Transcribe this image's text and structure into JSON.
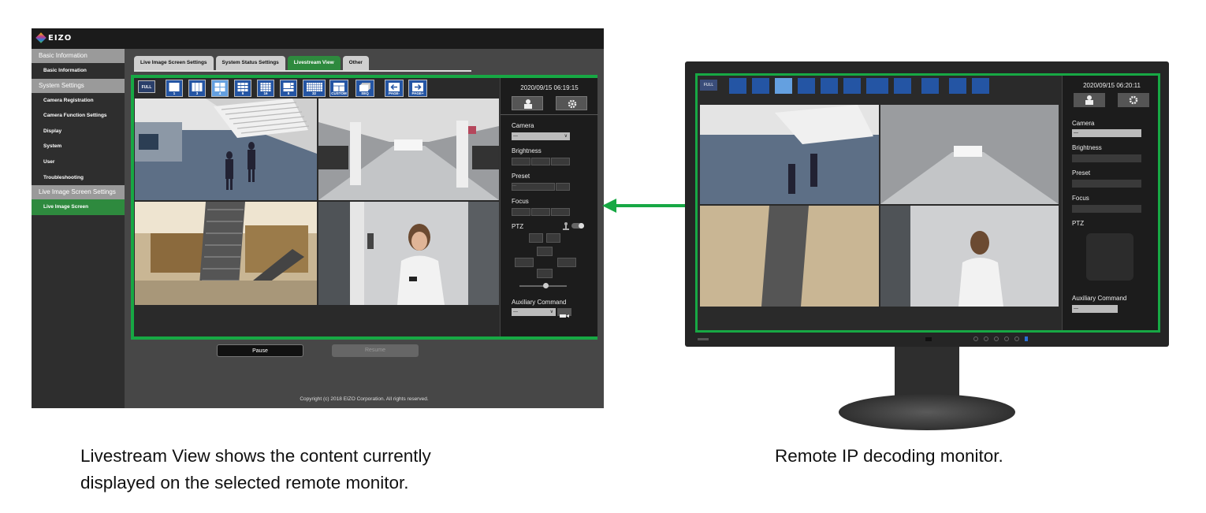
{
  "app": {
    "logo_text": "EIZO",
    "sidebar": {
      "sections": [
        {
          "heading": "Basic Information",
          "items": [
            "Basic Information"
          ]
        },
        {
          "heading": "System Settings",
          "items": [
            "Camera Registration",
            "Camera Function Settings",
            "Display",
            "System",
            "User",
            "Troubleshooting"
          ]
        },
        {
          "heading": "Live Image Screen Settings",
          "items": [
            "Live Image Screen"
          ]
        }
      ]
    },
    "tabs": [
      "Live Image Screen Settings",
      "System Status Settings",
      "Livestream View",
      "Other"
    ],
    "active_tab": "Livestream View",
    "toolbar": [
      {
        "label": "FULL",
        "icon": "full-icon"
      },
      {
        "label": "1",
        "icon": "layout-1-icon"
      },
      {
        "label": "3",
        "icon": "layout-3-icon"
      },
      {
        "label": "4",
        "icon": "layout-4-icon",
        "selected": true
      },
      {
        "label": "9",
        "icon": "layout-9-icon"
      },
      {
        "label": "16",
        "icon": "layout-16-icon"
      },
      {
        "label": "8",
        "icon": "layout-8-icon"
      },
      {
        "label": "32",
        "icon": "layout-32-icon"
      },
      {
        "label": "CUSTOM",
        "icon": "layout-custom-icon"
      },
      {
        "label": "SEQ",
        "icon": "sequence-icon"
      },
      {
        "label": "PAGE-",
        "icon": "arrow-left-icon"
      },
      {
        "label": "PAGE+",
        "icon": "arrow-right-icon"
      }
    ],
    "panel": {
      "datetime": "2020/09/15 06:19:15",
      "camera_label": "Camera",
      "camera_value": "---",
      "brightness_label": "Brightness",
      "preset_label": "Preset",
      "preset_value": "---",
      "focus_label": "Focus",
      "ptz_label": "PTZ",
      "aux_label": "Auxiliary Command",
      "aux_value": "---"
    },
    "pause_label": "Pause",
    "resume_label": "Resume",
    "copyright": "Copyright (c) 2018 EIZO Corporation. All rights reserved."
  },
  "monitor": {
    "datetime": "2020/09/15 06:20:11",
    "camera_label": "Camera",
    "camera_value": "---",
    "brightness_label": "Brightness",
    "preset_label": "Preset",
    "focus_label": "Focus",
    "ptz_label": "PTZ",
    "aux_label": "Auxiliary Command",
    "aux_value": "---"
  },
  "captions": {
    "left_line1": "Livestream View shows the content currently",
    "left_line2": "displayed on the selected remote monitor.",
    "right": "Remote IP decoding monitor."
  },
  "colors": {
    "accent_green": "#17a844",
    "toolbar_blue": "#2455a4",
    "active_tab": "#2e8a3e"
  }
}
